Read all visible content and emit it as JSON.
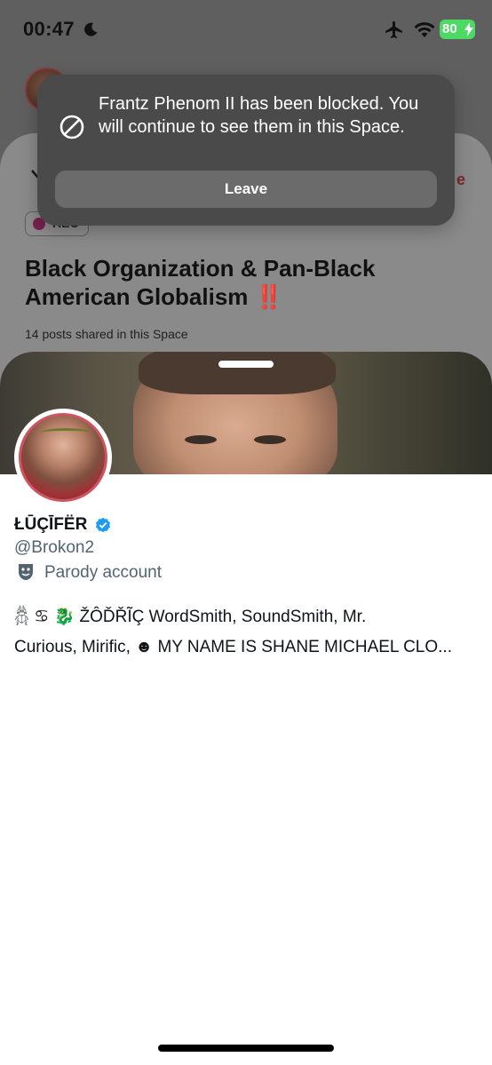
{
  "status_bar": {
    "time": "00:47",
    "battery": "80",
    "battery_color": "#4cd964"
  },
  "background_space": {
    "leave_label": "e",
    "rec_label": "REC",
    "title": "Black Organization & Pan-Black American Globalism",
    "title_emoji": "‼️",
    "posts_shared": "14 posts shared in this Space"
  },
  "toast": {
    "icon": "blocked-icon",
    "message": "Frantz Phenom II has been blocked. You will continue to see them in this Space.",
    "button_label": "Leave"
  },
  "profile": {
    "display_name": "ŁŪÇĪFËR",
    "handle": "@Brokon2",
    "parody_label": "Parody account",
    "bio_line1": "𓆣 ♋ 🐉 ŽÔĎŘĨÇ WordSmith, SoundSmith, Mr.",
    "bio_line2": "Curious, Mirific, ☻ MY NAME IS SHANE MICHAEL CLO...",
    "verified_color": "#1d9bf0"
  }
}
